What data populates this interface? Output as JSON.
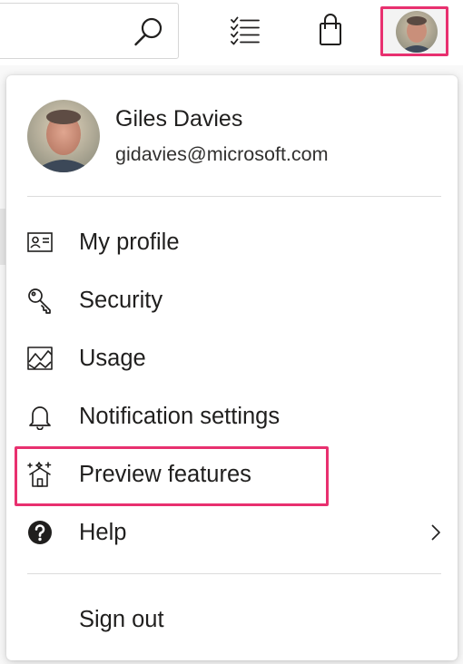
{
  "user": {
    "name": "Giles Davies",
    "email": "gidavies@microsoft.com"
  },
  "top_icons": [
    "search-icon",
    "checklist-icon",
    "shopping-bag-icon",
    "avatar"
  ],
  "menu": {
    "items": [
      {
        "label": "My profile",
        "icon": "contact-card-icon"
      },
      {
        "label": "Security",
        "icon": "key-icon"
      },
      {
        "label": "Usage",
        "icon": "usage-chart-icon"
      },
      {
        "label": "Notification settings",
        "icon": "bell-icon"
      },
      {
        "label": "Preview features",
        "icon": "preview-sparkle-icon"
      },
      {
        "label": "Help",
        "icon": "help-circle-icon"
      }
    ],
    "sign_out_label": "Sign out"
  },
  "colors": {
    "highlight": "#e8306f",
    "divider": "#dcdcdc",
    "text": "#201f1e"
  }
}
